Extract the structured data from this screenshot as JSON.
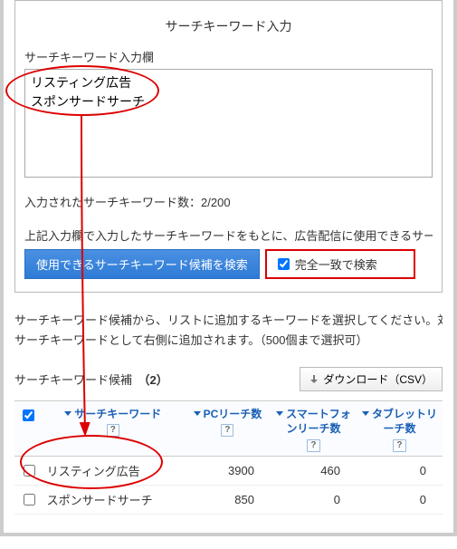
{
  "panel": {
    "title": "サーチキーワード入力",
    "input_label": "サーチキーワード入力欄",
    "textarea_value": "リスティング広告\nスポンサードサーチ",
    "count_label": "入力されたサーチキーワード数：",
    "count_value": "2/200",
    "instruction": "上記入力欄で入力したサーチキーワードをもとに、広告配信に使用できるサーチキー",
    "search_button": "使用できるサーチキーワード候補を検索",
    "exact_match_label": "完全一致で検索",
    "exact_match_checked": true
  },
  "lower": {
    "desc_line1": "サーチキーワード候補から、リストに追加するキーワードを選択してください。対象",
    "desc_line2": "サーチキーワードとして右側に追加されます。（500個まで選択可）",
    "candidates_label": "サーチキーワード候補",
    "candidates_count": "（2）",
    "download_label": "ダウンロード（CSV）"
  },
  "table": {
    "headers": {
      "keyword": "サーチキーワード",
      "pc_reach": "PCリーチ数",
      "sp_reach": "スマートフォンリーチ数",
      "tablet_reach": "タブレットリーチ数"
    },
    "help_symbol": "?",
    "header_checked": true,
    "rows": [
      {
        "checked": false,
        "keyword": "リスティング広告",
        "pc": "3900",
        "sp": "460",
        "tablet": "0"
      },
      {
        "checked": false,
        "keyword": "スポンサードサーチ",
        "pc": "850",
        "sp": "0",
        "tablet": "0"
      }
    ]
  }
}
